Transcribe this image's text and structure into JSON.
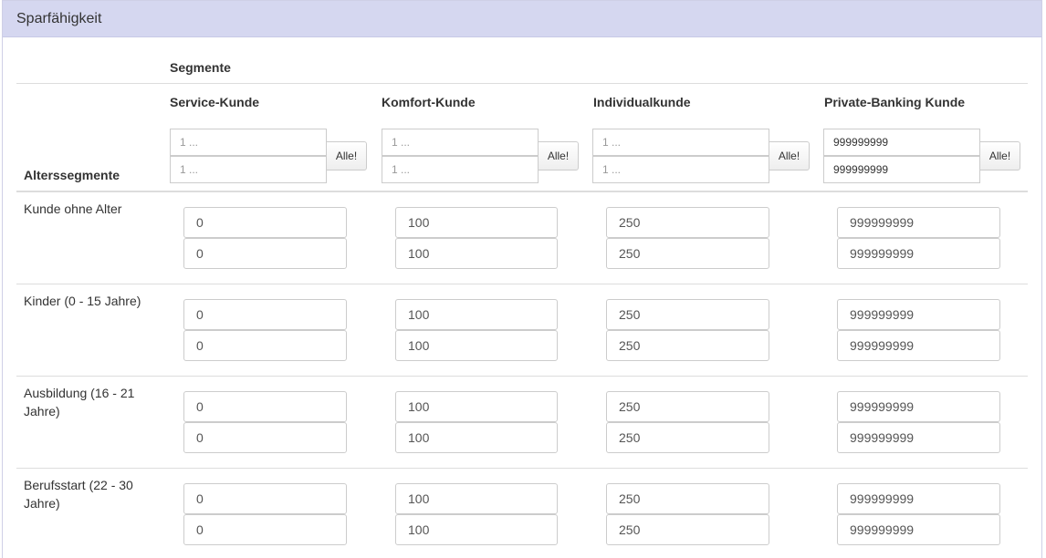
{
  "panel": {
    "title": "Sparfähigkeit"
  },
  "header": {
    "segmente_label": "Segmente",
    "alterssegmente_label": "Alterssegmente",
    "columns": [
      {
        "name": "Service-Kunde",
        "min_placeholder": "1 ...",
        "max_placeholder": "1 ...",
        "min_value": "",
        "max_value": "",
        "button": "Alle!"
      },
      {
        "name": "Komfort-Kunde",
        "min_placeholder": "1 ...",
        "max_placeholder": "1 ...",
        "min_value": "",
        "max_value": "",
        "button": "Alle!"
      },
      {
        "name": "Individualkunde",
        "min_placeholder": "1 ...",
        "max_placeholder": "1 ...",
        "min_value": "",
        "max_value": "",
        "button": "Alle!"
      },
      {
        "name": "Private-Banking Kunde",
        "min_placeholder": "1 ...",
        "max_placeholder": "1 ...",
        "min_value": "999999999",
        "max_value": "999999999",
        "button": "Alle!"
      }
    ]
  },
  "rows": [
    {
      "label": "Kunde ohne Alter",
      "values": [
        [
          "0",
          "0"
        ],
        [
          "100",
          "100"
        ],
        [
          "250",
          "250"
        ],
        [
          "999999999",
          "999999999"
        ]
      ]
    },
    {
      "label": "Kinder (0 - 15 Jahre)",
      "values": [
        [
          "0",
          "0"
        ],
        [
          "100",
          "100"
        ],
        [
          "250",
          "250"
        ],
        [
          "999999999",
          "999999999"
        ]
      ]
    },
    {
      "label": "Ausbildung (16 - 21 Jahre)",
      "values": [
        [
          "0",
          "0"
        ],
        [
          "100",
          "100"
        ],
        [
          "250",
          "250"
        ],
        [
          "999999999",
          "999999999"
        ]
      ]
    },
    {
      "label": "Berufsstart (22 - 30 Jahre)",
      "values": [
        [
          "0",
          "0"
        ],
        [
          "100",
          "100"
        ],
        [
          "250",
          "250"
        ],
        [
          "999999999",
          "999999999"
        ]
      ]
    }
  ]
}
